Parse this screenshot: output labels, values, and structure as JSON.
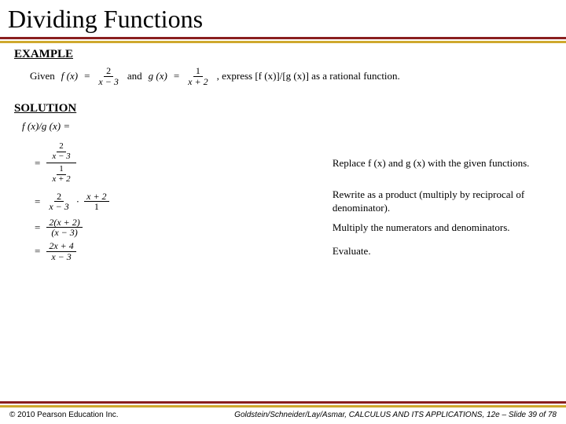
{
  "title": "Dividing Functions",
  "headings": {
    "example": "EXAMPLE",
    "solution": "SOLUTION"
  },
  "given": {
    "given_word": "Given",
    "f_lhs": "f (x)",
    "f_num": "2",
    "f_den": "x − 3",
    "and_word": "and",
    "g_lhs": "g (x)",
    "g_num": "1",
    "g_den": "x + 2",
    "tail": ", express [f (x)]/[g (x)] as a rational function."
  },
  "solution_expr": "f (x)/g (x) =",
  "steps": [
    {
      "math": {
        "eq": "=",
        "outer_top_num": "2",
        "outer_top_den": "x − 3",
        "outer_bot_num": "1",
        "outer_bot_den": "x + 2"
      },
      "desc": "Replace f (x) and g (x) with the given functions."
    },
    {
      "math": {
        "eq": "=",
        "a_num": "2",
        "a_den": "x − 3",
        "dot": "·",
        "b_num": "x + 2",
        "b_den": "1"
      },
      "desc": "Rewrite as a product (multiply by reciprocal of denominator)."
    },
    {
      "math": {
        "eq": "=",
        "num": "2(x + 2)",
        "den": "(x − 3)"
      },
      "desc": "Multiply the numerators and denominators."
    },
    {
      "math": {
        "eq": "=",
        "num": "2x + 4",
        "den": "x − 3"
      },
      "desc": "Evaluate."
    }
  ],
  "footer": {
    "left": "© 2010 Pearson Education Inc.",
    "right": "Goldstein/Schneider/Lay/Asmar, CALCULUS AND ITS APPLICATIONS, 12e – Slide 39 of 78"
  }
}
